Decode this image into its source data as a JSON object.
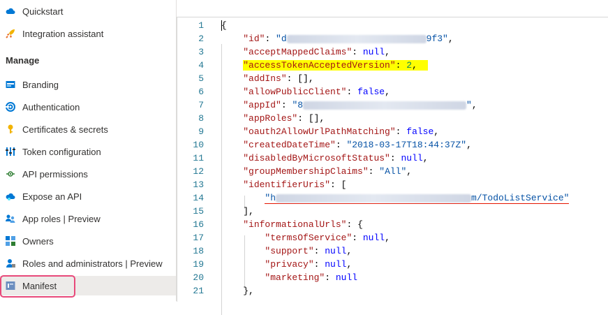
{
  "sidebar": {
    "items_top": [
      {
        "label": "Quickstart",
        "icon": "cloud-icon"
      },
      {
        "label": "Integration assistant",
        "icon": "rocket-icon"
      }
    ],
    "section_label": "Manage",
    "items_manage": [
      {
        "label": "Branding",
        "icon": "branding-icon"
      },
      {
        "label": "Authentication",
        "icon": "authentication-icon"
      },
      {
        "label": "Certificates & secrets",
        "icon": "key-icon"
      },
      {
        "label": "Token configuration",
        "icon": "token-config-icon"
      },
      {
        "label": "API permissions",
        "icon": "api-permissions-icon"
      },
      {
        "label": "Expose an API",
        "icon": "cloud-api-icon"
      },
      {
        "label": "App roles | Preview",
        "icon": "app-roles-icon"
      },
      {
        "label": "Owners",
        "icon": "owners-icon"
      },
      {
        "label": "Roles and administrators | Preview",
        "icon": "roles-admin-icon"
      },
      {
        "label": "Manifest",
        "icon": "manifest-icon",
        "selected": true
      }
    ]
  },
  "colors": {
    "accent": "#0078d4",
    "highlight_box": "#e8497a",
    "json_key": "#a31515",
    "json_string": "#0451a5",
    "json_number": "#098658",
    "json_keyword": "#0000ff",
    "line_number": "#237893",
    "selection": "#ffff00"
  },
  "editor": {
    "line_numbers": [
      "1",
      "2",
      "3",
      "4",
      "5",
      "6",
      "7",
      "8",
      "9",
      "10",
      "11",
      "12",
      "13",
      "14",
      "15",
      "16",
      "17",
      "18",
      "19",
      "20",
      "21"
    ],
    "lines": {
      "l1": "{",
      "l2_key": "\"id\"",
      "l2_pre": "\"d",
      "l2_post": "9f3\"",
      "l3_key": "\"acceptMappedClaims\"",
      "l3_val": "null",
      "l4_key": "\"accessTokenAcceptedVersion\"",
      "l4_val": "2",
      "l5_key": "\"addIns\"",
      "l5_val": "[]",
      "l6_key": "\"allowPublicClient\"",
      "l6_val": "false",
      "l7_key": "\"appId\"",
      "l7_pre": "\"8",
      "l7_post": "\"",
      "l8_key": "\"appRoles\"",
      "l8_val": "[]",
      "l9_key": "\"oauth2AllowUrlPathMatching\"",
      "l9_val": "false",
      "l10_key": "\"createdDateTime\"",
      "l10_val": "\"2018-03-17T18:44:37Z\"",
      "l11_key": "\"disabledByMicrosoftStatus\"",
      "l11_val": "null",
      "l12_key": "\"groupMembershipClaims\"",
      "l12_val": "\"All\"",
      "l13_key": "\"identifierUris\"",
      "l13_val": "[",
      "l14_pre": "\"h",
      "l14_mid": "m/TodoListService",
      "l14_post": "\"",
      "l15": "],",
      "l16_key": "\"informationalUrls\"",
      "l16_val": "{",
      "l17_key": "\"termsOfService\"",
      "l17_val": "null",
      "l18_key": "\"support\"",
      "l18_val": "null",
      "l19_key": "\"privacy\"",
      "l19_val": "null",
      "l20_key": "\"marketing\"",
      "l20_val": "null",
      "l21": "},"
    }
  }
}
